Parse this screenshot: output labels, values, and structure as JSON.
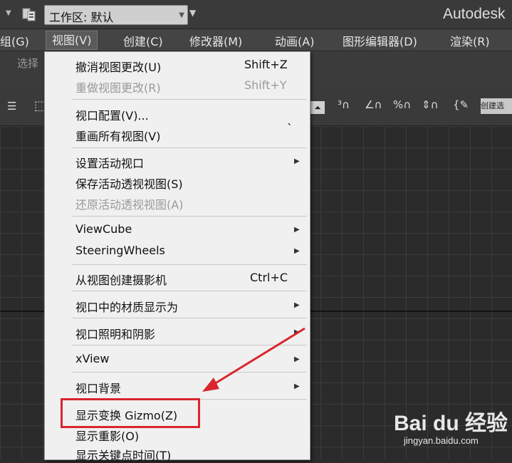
{
  "titlebar": {
    "workspace_label": "工作区: 默认",
    "app_title": "Autodesk"
  },
  "menubar": {
    "items": [
      "组(G)",
      "视图(V)",
      "创建(C)",
      "修改器(M)",
      "动画(A)",
      "图形编辑器(D)",
      "渲染(R)"
    ]
  },
  "ribbon": {
    "label": "选择"
  },
  "toolbar": {
    "tag_text": "创建选"
  },
  "view_menu": {
    "items": [
      {
        "label": "撤消视图更改(U)",
        "shortcut": "Shift+Z",
        "disabled": false
      },
      {
        "label": "重做视图更改(R)",
        "shortcut": "Shift+Y",
        "disabled": true
      },
      {
        "label": "视口配置(V)...",
        "shortcut": "",
        "disabled": false
      },
      {
        "label": "重画所有视图(V)",
        "shortcut": "`",
        "disabled": false
      },
      {
        "label": "设置活动视口",
        "shortcut": "",
        "disabled": false,
        "submenu": true
      },
      {
        "label": "保存活动透视视图(S)",
        "shortcut": "",
        "disabled": false
      },
      {
        "label": "还原活动透视视图(A)",
        "shortcut": "",
        "disabled": true
      },
      {
        "label": "ViewCube",
        "shortcut": "",
        "disabled": false,
        "submenu": true
      },
      {
        "label": "SteeringWheels",
        "shortcut": "",
        "disabled": false,
        "submenu": true
      },
      {
        "label": "从视图创建摄影机",
        "shortcut": "Ctrl+C",
        "disabled": false
      },
      {
        "label": "视口中的材质显示为",
        "shortcut": "",
        "disabled": false,
        "submenu": true
      },
      {
        "label": "视口照明和阴影",
        "shortcut": "",
        "disabled": false,
        "submenu": true
      },
      {
        "label": "xView",
        "shortcut": "",
        "disabled": false,
        "submenu": true
      },
      {
        "label": "视口背景",
        "shortcut": "",
        "disabled": false,
        "submenu": true
      },
      {
        "label": "显示变换 Gizmo(Z)",
        "shortcut": "",
        "disabled": false
      },
      {
        "label": "显示重影(O)",
        "shortcut": "",
        "disabled": false
      },
      {
        "label": "显示关键点时间(T)",
        "shortcut": "",
        "disabled": false
      }
    ]
  },
  "annotation": {
    "color": "#d8262c"
  },
  "watermark": {
    "brand": "Bai du 经验",
    "url": "jingyan.baidu.com"
  }
}
